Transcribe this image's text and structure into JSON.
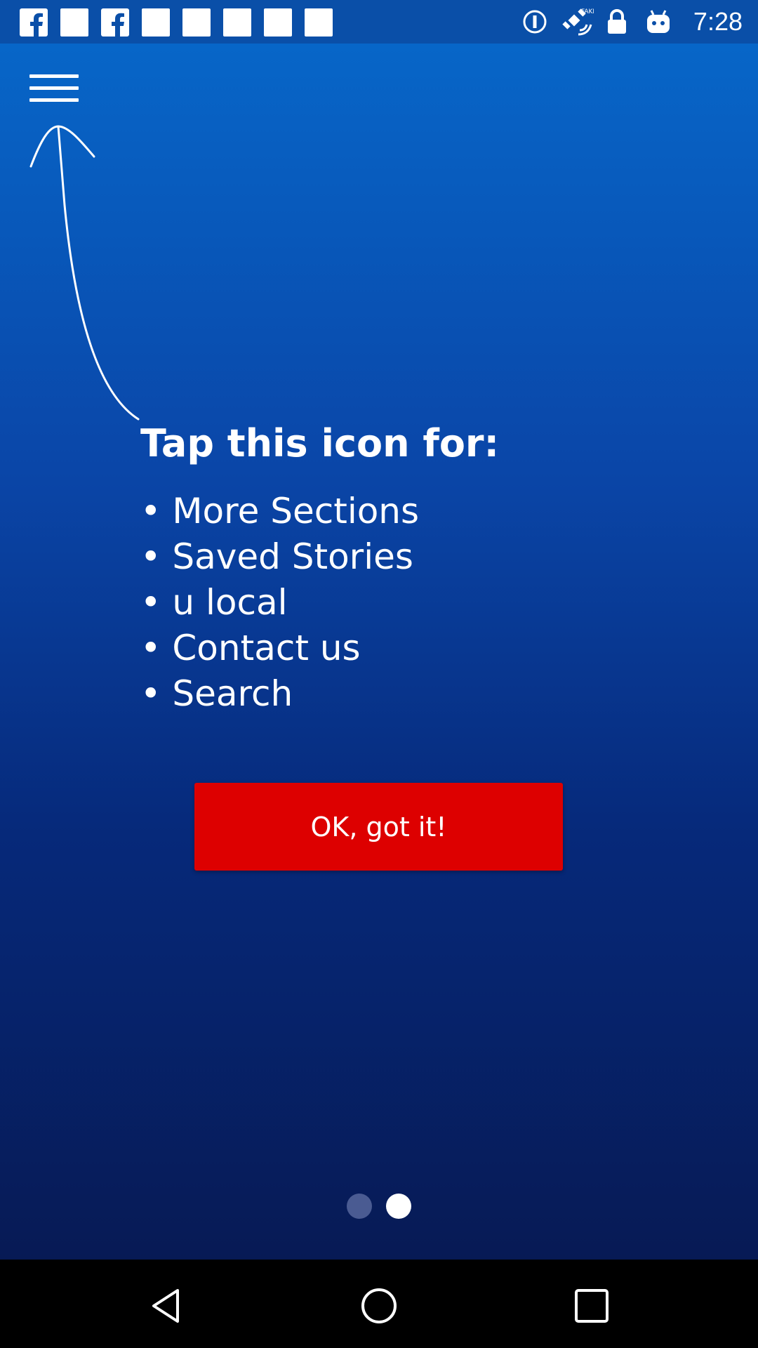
{
  "status_bar": {
    "time": "7:28",
    "left_icons": [
      "facebook-icon",
      "square-notification-icon",
      "facebook-icon",
      "square-notification-icon",
      "square-notification-icon",
      "square-notification-icon",
      "square-notification-icon",
      "square-notification-icon"
    ],
    "right_icons": [
      "info-circle-icon",
      "satellite-icon",
      "lock-icon",
      "android-icon"
    ]
  },
  "overlay": {
    "heading": "Tap this icon for:",
    "items": [
      {
        "label": "More Sections"
      },
      {
        "label": "Saved Stories"
      },
      {
        "label": "u local"
      },
      {
        "label": "Contact us"
      },
      {
        "label": "Search"
      }
    ],
    "ok_button_label": "OK, got it!"
  },
  "pager": {
    "count": 2,
    "active_index": 1
  },
  "colors": {
    "button_red": "#dd0000",
    "gradient_top": "#0766c8",
    "gradient_bottom": "#071a55"
  },
  "nav_bar": {
    "icons": [
      "back-icon",
      "home-icon",
      "recents-icon"
    ]
  }
}
